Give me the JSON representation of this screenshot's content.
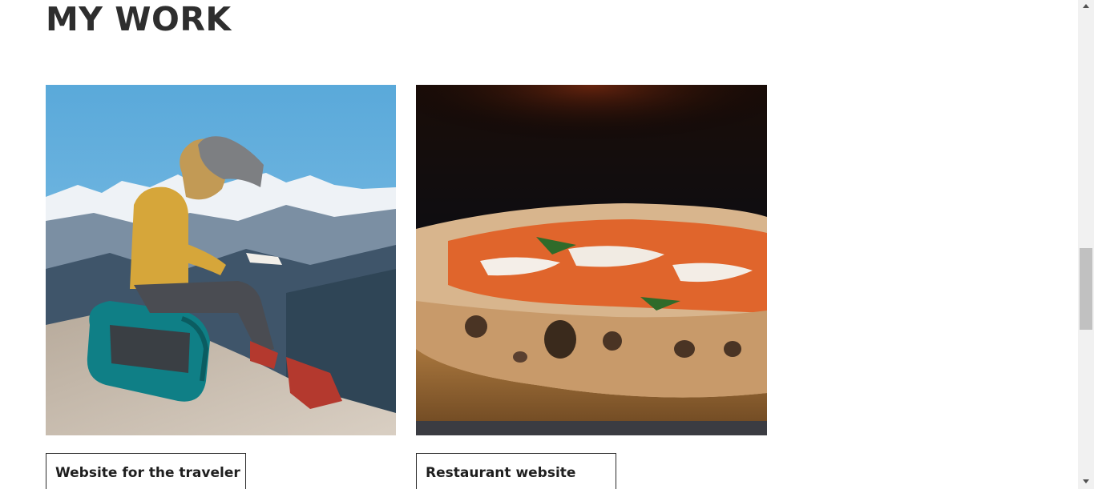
{
  "section": {
    "title": "MY WORK"
  },
  "projects": [
    {
      "caption": "Website for the traveler",
      "image": "hiker-sketching-on-mountain-photo"
    },
    {
      "caption": "Restaurant website",
      "image": "neapolitan-pizza-photo"
    }
  ],
  "scrollbar": {
    "position": 0.5
  }
}
